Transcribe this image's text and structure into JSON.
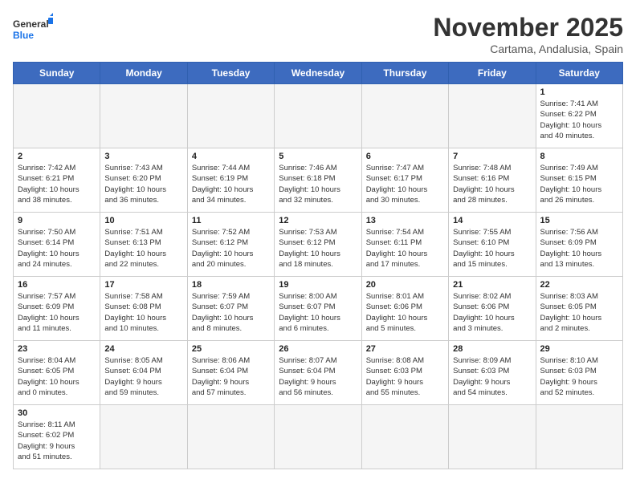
{
  "logo": {
    "general": "General",
    "blue": "Blue"
  },
  "header": {
    "month": "November 2025",
    "location": "Cartama, Andalusia, Spain"
  },
  "days_of_week": [
    "Sunday",
    "Monday",
    "Tuesday",
    "Wednesday",
    "Thursday",
    "Friday",
    "Saturday"
  ],
  "weeks": [
    [
      {
        "day": "",
        "info": ""
      },
      {
        "day": "",
        "info": ""
      },
      {
        "day": "",
        "info": ""
      },
      {
        "day": "",
        "info": ""
      },
      {
        "day": "",
        "info": ""
      },
      {
        "day": "",
        "info": ""
      },
      {
        "day": "1",
        "info": "Sunrise: 7:41 AM\nSunset: 6:22 PM\nDaylight: 10 hours\nand 40 minutes."
      }
    ],
    [
      {
        "day": "2",
        "info": "Sunrise: 7:42 AM\nSunset: 6:21 PM\nDaylight: 10 hours\nand 38 minutes."
      },
      {
        "day": "3",
        "info": "Sunrise: 7:43 AM\nSunset: 6:20 PM\nDaylight: 10 hours\nand 36 minutes."
      },
      {
        "day": "4",
        "info": "Sunrise: 7:44 AM\nSunset: 6:19 PM\nDaylight: 10 hours\nand 34 minutes."
      },
      {
        "day": "5",
        "info": "Sunrise: 7:46 AM\nSunset: 6:18 PM\nDaylight: 10 hours\nand 32 minutes."
      },
      {
        "day": "6",
        "info": "Sunrise: 7:47 AM\nSunset: 6:17 PM\nDaylight: 10 hours\nand 30 minutes."
      },
      {
        "day": "7",
        "info": "Sunrise: 7:48 AM\nSunset: 6:16 PM\nDaylight: 10 hours\nand 28 minutes."
      },
      {
        "day": "8",
        "info": "Sunrise: 7:49 AM\nSunset: 6:15 PM\nDaylight: 10 hours\nand 26 minutes."
      }
    ],
    [
      {
        "day": "9",
        "info": "Sunrise: 7:50 AM\nSunset: 6:14 PM\nDaylight: 10 hours\nand 24 minutes."
      },
      {
        "day": "10",
        "info": "Sunrise: 7:51 AM\nSunset: 6:13 PM\nDaylight: 10 hours\nand 22 minutes."
      },
      {
        "day": "11",
        "info": "Sunrise: 7:52 AM\nSunset: 6:12 PM\nDaylight: 10 hours\nand 20 minutes."
      },
      {
        "day": "12",
        "info": "Sunrise: 7:53 AM\nSunset: 6:12 PM\nDaylight: 10 hours\nand 18 minutes."
      },
      {
        "day": "13",
        "info": "Sunrise: 7:54 AM\nSunset: 6:11 PM\nDaylight: 10 hours\nand 17 minutes."
      },
      {
        "day": "14",
        "info": "Sunrise: 7:55 AM\nSunset: 6:10 PM\nDaylight: 10 hours\nand 15 minutes."
      },
      {
        "day": "15",
        "info": "Sunrise: 7:56 AM\nSunset: 6:09 PM\nDaylight: 10 hours\nand 13 minutes."
      }
    ],
    [
      {
        "day": "16",
        "info": "Sunrise: 7:57 AM\nSunset: 6:09 PM\nDaylight: 10 hours\nand 11 minutes."
      },
      {
        "day": "17",
        "info": "Sunrise: 7:58 AM\nSunset: 6:08 PM\nDaylight: 10 hours\nand 10 minutes."
      },
      {
        "day": "18",
        "info": "Sunrise: 7:59 AM\nSunset: 6:07 PM\nDaylight: 10 hours\nand 8 minutes."
      },
      {
        "day": "19",
        "info": "Sunrise: 8:00 AM\nSunset: 6:07 PM\nDaylight: 10 hours\nand 6 minutes."
      },
      {
        "day": "20",
        "info": "Sunrise: 8:01 AM\nSunset: 6:06 PM\nDaylight: 10 hours\nand 5 minutes."
      },
      {
        "day": "21",
        "info": "Sunrise: 8:02 AM\nSunset: 6:06 PM\nDaylight: 10 hours\nand 3 minutes."
      },
      {
        "day": "22",
        "info": "Sunrise: 8:03 AM\nSunset: 6:05 PM\nDaylight: 10 hours\nand 2 minutes."
      }
    ],
    [
      {
        "day": "23",
        "info": "Sunrise: 8:04 AM\nSunset: 6:05 PM\nDaylight: 10 hours\nand 0 minutes."
      },
      {
        "day": "24",
        "info": "Sunrise: 8:05 AM\nSunset: 6:04 PM\nDaylight: 9 hours\nand 59 minutes."
      },
      {
        "day": "25",
        "info": "Sunrise: 8:06 AM\nSunset: 6:04 PM\nDaylight: 9 hours\nand 57 minutes."
      },
      {
        "day": "26",
        "info": "Sunrise: 8:07 AM\nSunset: 6:04 PM\nDaylight: 9 hours\nand 56 minutes."
      },
      {
        "day": "27",
        "info": "Sunrise: 8:08 AM\nSunset: 6:03 PM\nDaylight: 9 hours\nand 55 minutes."
      },
      {
        "day": "28",
        "info": "Sunrise: 8:09 AM\nSunset: 6:03 PM\nDaylight: 9 hours\nand 54 minutes."
      },
      {
        "day": "29",
        "info": "Sunrise: 8:10 AM\nSunset: 6:03 PM\nDaylight: 9 hours\nand 52 minutes."
      }
    ],
    [
      {
        "day": "30",
        "info": "Sunrise: 8:11 AM\nSunset: 6:02 PM\nDaylight: 9 hours\nand 51 minutes."
      },
      {
        "day": "",
        "info": ""
      },
      {
        "day": "",
        "info": ""
      },
      {
        "day": "",
        "info": ""
      },
      {
        "day": "",
        "info": ""
      },
      {
        "day": "",
        "info": ""
      },
      {
        "day": "",
        "info": ""
      }
    ]
  ]
}
